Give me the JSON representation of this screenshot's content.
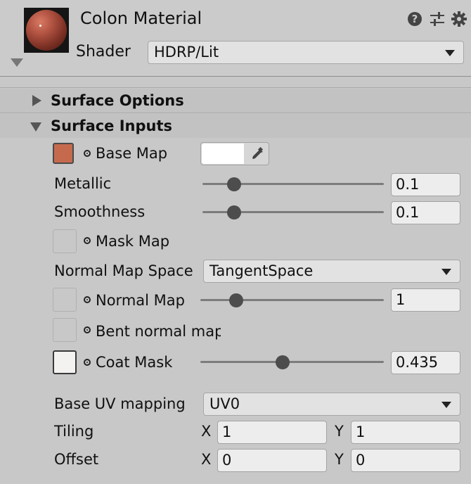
{
  "header": {
    "title": "Colon Material",
    "shader_label": "Shader",
    "shader_value": "HDRP/Lit"
  },
  "sections": {
    "surface_options": "Surface Options",
    "surface_inputs": "Surface Inputs"
  },
  "inputs": {
    "base_map": {
      "label": "Base Map",
      "color": "#c66a4e",
      "swatch_color": "#ffffff"
    },
    "metallic": {
      "label": "Metallic",
      "value": "0.1",
      "fraction": 0.1
    },
    "smoothness": {
      "label": "Smoothness",
      "value": "0.1",
      "fraction": 0.1
    },
    "mask_map": {
      "label": "Mask Map"
    },
    "normal_map_space": {
      "label": "Normal Map Space",
      "value": "TangentSpace"
    },
    "normal_map": {
      "label": "Normal Map",
      "value": "1",
      "fraction": 0.125
    },
    "bent_normal_map": {
      "label": "Bent normal map"
    },
    "coat_mask": {
      "label": "Coat Mask",
      "value": "0.435",
      "fraction": 0.435
    },
    "base_uv_mapping": {
      "label": "Base UV mapping",
      "value": "UV0"
    },
    "tiling": {
      "label": "Tiling",
      "x_label": "X",
      "x": "1",
      "y_label": "Y",
      "y": "1"
    },
    "offset": {
      "label": "Offset",
      "x_label": "X",
      "x": "0",
      "y_label": "Y",
      "y": "0"
    }
  },
  "icons": [
    "help-icon",
    "preset-sliders-icon",
    "gear-icon",
    "eyedropper-icon",
    "expand-arrow-icon"
  ]
}
